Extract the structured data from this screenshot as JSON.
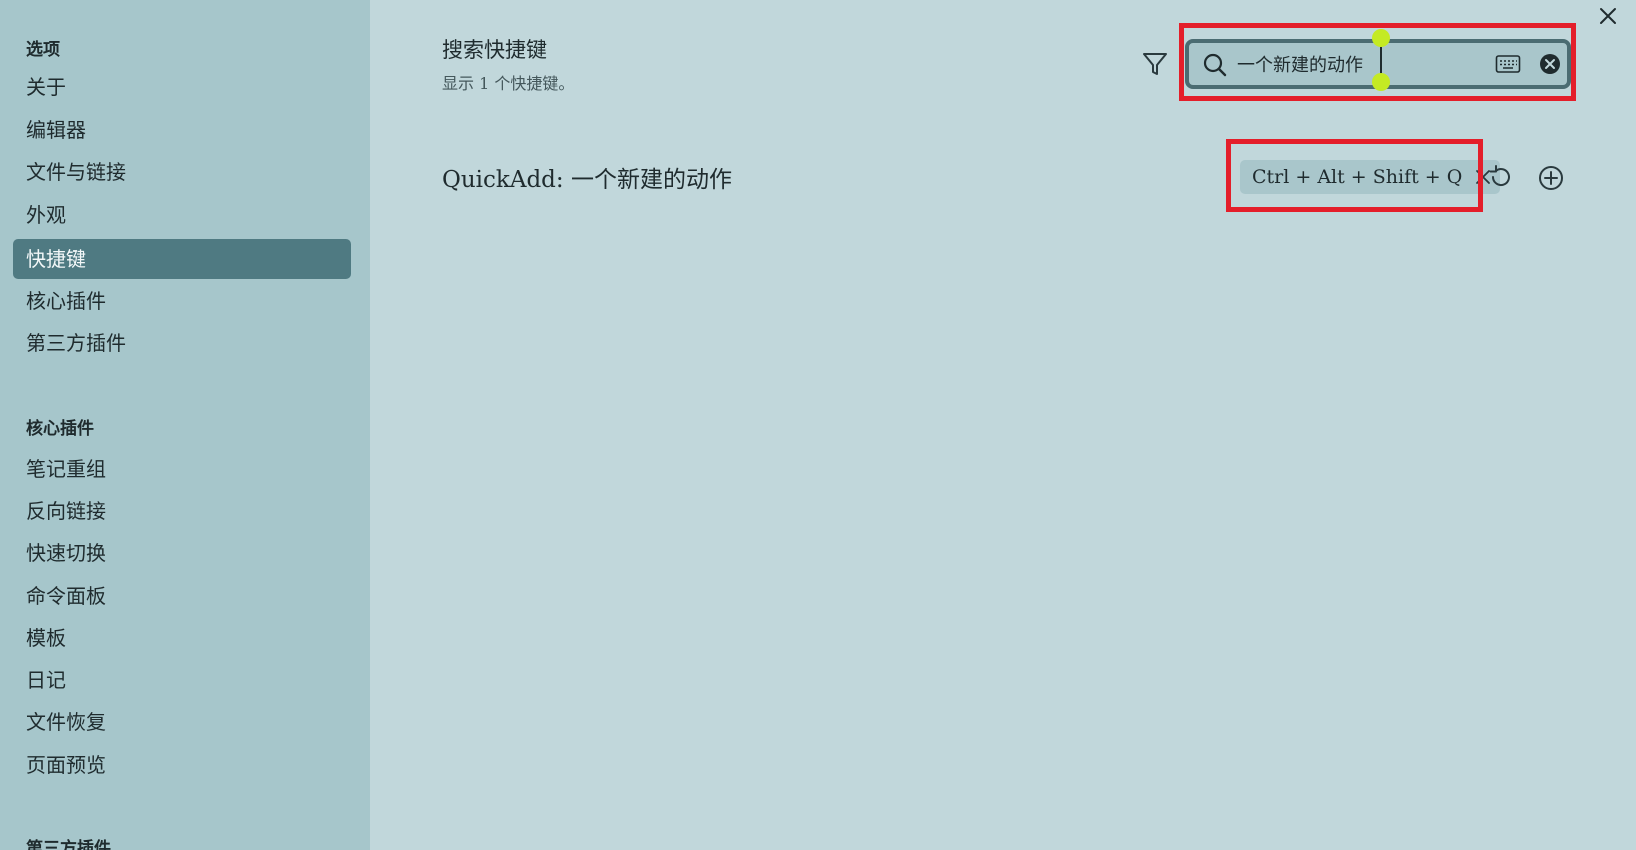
{
  "sidebar": {
    "sections": [
      {
        "title": "选项",
        "items": [
          "关于",
          "编辑器",
          "文件与链接",
          "外观",
          "快捷键",
          "核心插件",
          "第三方插件"
        ]
      },
      {
        "title": "核心插件",
        "items": [
          "笔记重组",
          "反向链接",
          "快速切换",
          "命令面板",
          "模板",
          "日记",
          "文件恢复",
          "页面预览"
        ]
      },
      {
        "title": "第三方插件",
        "items": []
      }
    ],
    "active_item": "快捷键"
  },
  "header": {
    "title": "搜索快捷键",
    "subtitle": "显示 1 个快捷键。"
  },
  "search": {
    "value": "一个新建的动作",
    "icons": [
      "search-icon",
      "keyboard-icon",
      "clear-icon"
    ]
  },
  "hotkeys": [
    {
      "command": "QuickAdd: 一个新建的动作",
      "binding": "Ctrl + Alt + Shift + Q"
    }
  ],
  "colors": {
    "background": "#c1d7db",
    "sidebar": "#a6c6cb",
    "active_item": "#4f7a82",
    "highlight": "#e41e2a",
    "selection_handle": "#c4ea24"
  }
}
